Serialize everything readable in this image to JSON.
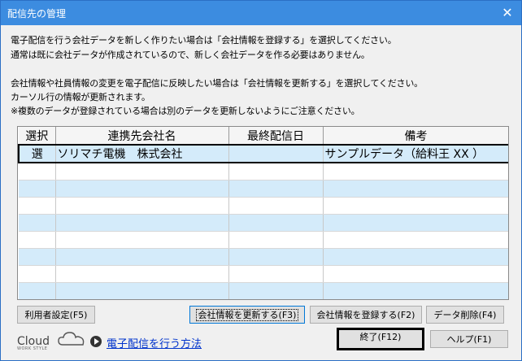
{
  "window": {
    "title": "配信先の管理",
    "close": "✕"
  },
  "messages": [
    "電子配信を行う会社データを新しく作りたい場合は「会社情報を登録する」を選択してください。",
    "通常は既に会社データが作成されているので、新しく会社データを作る必要はありません。",
    "会社情報や社員情報の変更を電子配信に反映したい場合は「会社情報を更新する」を選択してください。",
    "カーソル行の情報が更新されます。",
    "※複数のデータが登録されている場合は別のデータを更新しないようにご注意ください。"
  ],
  "grid": {
    "headers": [
      "選択",
      "連携先会社名",
      "最終配信日",
      "備考"
    ],
    "rows": [
      [
        "選",
        "ソリマチ電機　株式会社",
        "",
        "サンプルデータ（給料王 XX ）"
      ]
    ]
  },
  "buttons": {
    "user_settings": "利用者設定(F5)",
    "update_company": "会社情報を更新する(F3)",
    "register_company": "会社情報を登録する(F2)",
    "delete_data": "データ削除(F4)",
    "exit": "終了(F12)",
    "help": "ヘルプ(F1)"
  },
  "footer": {
    "logo_text": "Cloud",
    "logo_sub": "WORK STYLE",
    "help_link": "電子配信を行う方法"
  }
}
